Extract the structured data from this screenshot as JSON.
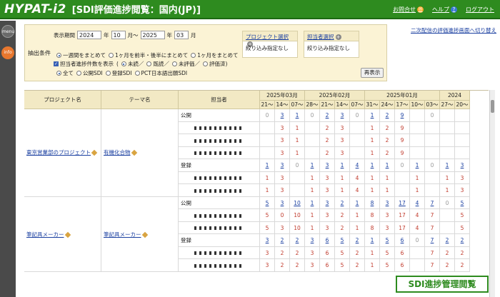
{
  "header": {
    "logo": "HYPAT-i2",
    "title": "[SDI評価進捗閲覧：国内(JP)]",
    "contact": "お問合せ",
    "help": "ヘルプ",
    "logout": "ログアウト",
    "bg_color": "#2e8b1f"
  },
  "sidebar": {
    "menu": "menu",
    "info": "info"
  },
  "filter": {
    "section_label": "抽出条件",
    "period_label": "表示期間",
    "from_year": "2024",
    "year_unit": "年",
    "from_month": "10",
    "month_to": "月～",
    "to_year": "2025",
    "to_month": "03",
    "month_unit": "月",
    "radio_weekly": "一週間をまとめて",
    "radio_half": "1ヶ月を前半・後半にまとめて",
    "radio_month": "1ヶ月をまとめて",
    "check_count": "担当者進捗件数を表示",
    "opt_unrated": "未読",
    "opt_browsed": "既読",
    "opt_unevaluated": "未評価",
    "opt_evaluated": "評価済",
    "radio_all": "全て",
    "radio_public": "公開SDI",
    "radio_reg": "登録SDI",
    "radio_pct": "PCT日本語出願SDI",
    "project_select": "プロジェクト選択",
    "owner_select": "担当者選択",
    "no_filter_1": "絞り込み指定なし",
    "no_filter_2": "絞り込み指定なし",
    "redisplay": "再表示",
    "switch_link": "二次配信の評価進捗画面へ切り替え"
  },
  "table": {
    "col_project": "プロジェクト名",
    "col_theme": "テーマ名",
    "col_owner": "担当者",
    "months": [
      "2025年03月",
      "2025年02月",
      "2025年01月",
      "2024"
    ],
    "weeks": [
      "21～",
      "14～",
      "07～",
      "28～",
      "21～",
      "14～",
      "07～",
      "31～",
      "24～",
      "17～",
      "10～",
      "03～",
      "27～",
      "20～"
    ],
    "projects": [
      {
        "name": "東京営業部のプロジェクト",
        "theme": "有機化合物",
        "groups": [
          {
            "label": "公開",
            "total": [
              "0",
              "3",
              "1",
              "0",
              "2",
              "3",
              "0",
              "1",
              "2",
              "9",
              "",
              "0",
              "",
              ""
            ],
            "owners": [
              [
                "",
                "3",
                "1",
                "",
                "2",
                "3",
                "",
                "1",
                "2",
                "9",
                "",
                "",
                "",
                ""
              ],
              [
                "",
                "3",
                "1",
                "",
                "2",
                "3",
                "",
                "1",
                "2",
                "9",
                "",
                "",
                "",
                ""
              ],
              [
                "",
                "3",
                "1",
                "",
                "2",
                "3",
                "",
                "1",
                "2",
                "9",
                "",
                "",
                "",
                ""
              ]
            ]
          },
          {
            "label": "登録",
            "total": [
              "1",
              "3",
              "0",
              "1",
              "3",
              "1",
              "4",
              "1",
              "1",
              "0",
              "1",
              "0",
              "1",
              "3"
            ],
            "owners": [
              [
                "1",
                "3",
                "",
                "1",
                "3",
                "1",
                "4",
                "1",
                "1",
                "",
                "1",
                "",
                "1",
                "3"
              ],
              [
                "1",
                "3",
                "",
                "1",
                "3",
                "1",
                "4",
                "1",
                "1",
                "",
                "1",
                "",
                "1",
                "3"
              ]
            ]
          }
        ]
      },
      {
        "name": "筆記具メーカー",
        "theme": "筆記具メーカー",
        "groups": [
          {
            "label": "公開",
            "total": [
              "5",
              "3",
              "10",
              "1",
              "3",
              "2",
              "1",
              "8",
              "3",
              "17",
              "4",
              "7",
              "0",
              "5"
            ],
            "owners": [
              [
                "5",
                "0",
                "10",
                "1",
                "3",
                "2",
                "1",
                "8",
                "3",
                "17",
                "4",
                "7",
                "",
                "5"
              ],
              [
                "5",
                "3",
                "10",
                "1",
                "3",
                "2",
                "1",
                "8",
                "3",
                "17",
                "4",
                "7",
                "",
                "5"
              ]
            ]
          },
          {
            "label": "登録",
            "total": [
              "3",
              "2",
              "2",
              "3",
              "6",
              "5",
              "2",
              "1",
              "5",
              "6",
              "0",
              "7",
              "2",
              "2"
            ],
            "owners": [
              [
                "3",
                "2",
                "2",
                "3",
                "6",
                "5",
                "2",
                "1",
                "5",
                "6",
                "",
                "7",
                "2",
                "2"
              ],
              [
                "3",
                "2",
                "2",
                "3",
                "6",
                "5",
                "2",
                "1",
                "5",
                "6",
                "",
                "7",
                "2",
                "2"
              ]
            ]
          }
        ]
      }
    ]
  },
  "badge": "SDI進捗管理閲覧"
}
